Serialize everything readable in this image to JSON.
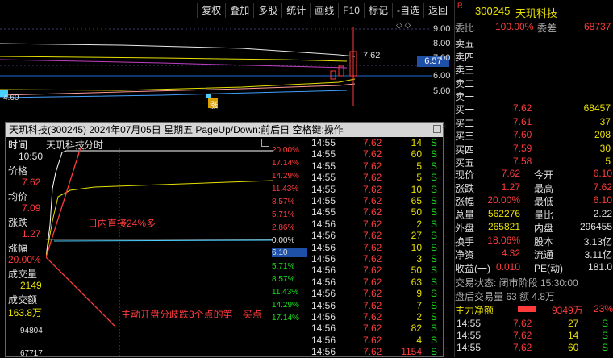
{
  "toolbar": {
    "items": [
      "复权",
      "叠加",
      "多股",
      "统计",
      "画线",
      "F10",
      "标记",
      "-自选",
      "返回"
    ]
  },
  "main_chart": {
    "y_labels": [
      "9.00",
      "8.00",
      "7.00",
      "6.00",
      "5.00"
    ],
    "price_tag": "7.62",
    "current_price": "6.57",
    "low_label": "4.60",
    "marker": "涨"
  },
  "popup": {
    "title": "天玑科技(300245) 2024年07月05日 星期五 PageUp/Down:前后日 空格键:操作",
    "header_time": "时间",
    "header_name": "天玑科技",
    "header_tab": "分时",
    "left": {
      "time_label": "时间",
      "time": "10:50",
      "price_label": "价格",
      "price": "7.62",
      "avg_label": "均价",
      "avg": "7.09",
      "chg_label": "涨跌",
      "chg": "1.27",
      "pct_label": "涨幅",
      "pct": "20.00%",
      "vol_label": "成交量",
      "vol": "2149",
      "amt_label": "成交额",
      "amt": "163.8万",
      "v1": "94804",
      "v2": "67717"
    },
    "pct_scale_up": [
      "20.00%",
      "17.14%",
      "14.29%",
      "11.43%",
      "8.57%",
      "5.71%",
      "2.86%"
    ],
    "pct_zero": "0.00%",
    "open_price": "6.10",
    "pct_scale_down": [
      "5.71%",
      "8.57%",
      "11.43%",
      "14.29%",
      "17.14%"
    ],
    "annotation1": "日内直接24%多",
    "annotation2": "主动开盘分歧跌3个点的第一买点",
    "ticks": [
      {
        "t": "14:55",
        "p": "7.62",
        "v": "14",
        "s": "S"
      },
      {
        "t": "14:55",
        "p": "7.62",
        "v": "60",
        "s": "S"
      },
      {
        "t": "14:55",
        "p": "7.62",
        "v": "5",
        "s": "S"
      },
      {
        "t": "14:55",
        "p": "7.62",
        "v": "5",
        "s": "S"
      },
      {
        "t": "14:55",
        "p": "7.62",
        "v": "10",
        "s": "S"
      },
      {
        "t": "14:55",
        "p": "7.62",
        "v": "65",
        "s": "S"
      },
      {
        "t": "14:55",
        "p": "7.62",
        "v": "50",
        "s": "S"
      },
      {
        "t": "14:56",
        "p": "7.62",
        "v": "2",
        "s": "S"
      },
      {
        "t": "14:56",
        "p": "7.62",
        "v": "27",
        "s": "S"
      },
      {
        "t": "14:56",
        "p": "7.62",
        "v": "10",
        "s": "S"
      },
      {
        "t": "14:56",
        "p": "7.62",
        "v": "3",
        "s": "S"
      },
      {
        "t": "14:56",
        "p": "7.62",
        "v": "50",
        "s": "S"
      },
      {
        "t": "14:56",
        "p": "7.62",
        "v": "63",
        "s": "S"
      },
      {
        "t": "14:56",
        "p": "7.62",
        "v": "9",
        "s": "S"
      },
      {
        "t": "14:56",
        "p": "7.62",
        "v": "7",
        "s": "S"
      },
      {
        "t": "14:56",
        "p": "7.62",
        "v": "2",
        "s": "S"
      },
      {
        "t": "14:56",
        "p": "7.62",
        "v": "82",
        "s": "S"
      },
      {
        "t": "14:56",
        "p": "7.62",
        "v": "4",
        "s": "S"
      },
      {
        "t": "14:56",
        "p": "7.62",
        "v": "1154",
        "s": "S"
      }
    ]
  },
  "right": {
    "badge": "R",
    "code": "300245",
    "name": "天玑科技",
    "ratio_label": "委比",
    "ratio": "100.00%",
    "diff_label": "委差",
    "diff": "68737",
    "asks": [
      "卖五",
      "卖四",
      "卖三",
      "卖二",
      "卖一"
    ],
    "bids": [
      {
        "l": "买一",
        "p": "7.62",
        "v": "68457"
      },
      {
        "l": "买二",
        "p": "7.61",
        "v": "37"
      },
      {
        "l": "买三",
        "p": "7.60",
        "v": "208"
      },
      {
        "l": "买四",
        "p": "7.59",
        "v": "30"
      },
      {
        "l": "买五",
        "p": "7.58",
        "v": "5"
      }
    ],
    "stats": [
      {
        "a": "现价",
        "av": "7.62",
        "b": "今开",
        "bv": "6.10"
      },
      {
        "a": "涨跌",
        "av": "1.27",
        "b": "最高",
        "bv": "7.62"
      },
      {
        "a": "涨幅",
        "av": "20.00%",
        "b": "最低",
        "bv": "6.10"
      },
      {
        "a": "总量",
        "av": "562276",
        "b": "量比",
        "bv": "2.22"
      },
      {
        "a": "外盘",
        "av": "265821",
        "b": "内盘",
        "bv": "296455"
      },
      {
        "a": "换手",
        "av": "18.06%",
        "b": "股本",
        "bv": "3.13亿"
      },
      {
        "a": "净资",
        "av": "4.32",
        "b": "流通",
        "bv": "3.11亿"
      },
      {
        "a": "收益(一)",
        "av": "0.010",
        "b": "PE(动)",
        "bv": "181.0"
      }
    ],
    "status": "交易状态: 闭市阶段 15:30:00",
    "after": "盘后交易量 63 额 4.8万",
    "net_label": "主力净额",
    "net_val": "9349万",
    "net_pct": "23%",
    "trades": [
      {
        "t": "14:55",
        "p": "7.62",
        "v": "27",
        "s": "S"
      },
      {
        "t": "14:55",
        "p": "7.62",
        "v": "14",
        "s": "S"
      },
      {
        "t": "14:55",
        "p": "7.62",
        "v": "60",
        "s": "S"
      }
    ]
  },
  "colors": {
    "up": "#ff3c3c",
    "down": "#19e019",
    "accent": "#e8e000"
  }
}
